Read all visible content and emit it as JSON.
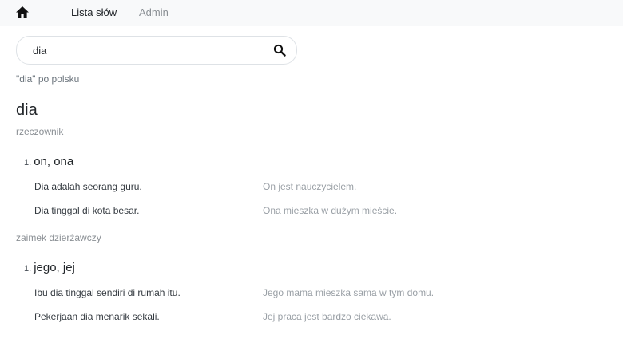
{
  "nav": {
    "home_icon": "home-icon",
    "links": [
      "Lista słów",
      "Admin"
    ]
  },
  "search": {
    "value": "dia",
    "icon": "search-icon"
  },
  "caption": "\"dia\" po polsku",
  "entry": {
    "headword": "dia",
    "groups": [
      {
        "pos": "rzeczownik",
        "senses": [
          {
            "number": "1.",
            "meaning": "on, ona",
            "examples": [
              {
                "source": "Dia adalah seorang guru.",
                "translation": "On jest nauczycielem."
              },
              {
                "source": "Dia tinggal di kota besar.",
                "translation": "Ona mieszka w dużym mieście."
              }
            ]
          }
        ]
      },
      {
        "pos": "zaimek dzierżawczy",
        "senses": [
          {
            "number": "1.",
            "meaning": "jego, jej",
            "examples": [
              {
                "source": "Ibu dia tinggal sendiri di rumah itu.",
                "translation": "Jego mama mieszka sama w tym domu."
              },
              {
                "source": "Pekerjaan dia menarik sekali.",
                "translation": "Jej praca jest bardzo ciekawa."
              }
            ]
          }
        ]
      }
    ]
  },
  "colors": {
    "navbar_bg": "#f8f9fa",
    "muted_text": "#8a8f94",
    "translation_text": "#9aa0a6"
  }
}
